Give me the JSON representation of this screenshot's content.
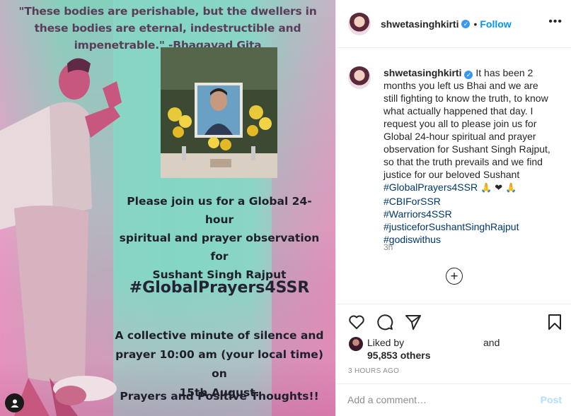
{
  "image": {
    "quote": "\"These bodies are perishable, but the dwellers in these bodies are eternal, indestructible and impenetrable.\" -Bhagavad Gita",
    "join_line1": "Please join us for a Global 24-hour",
    "join_line2": "spiritual and prayer observation for",
    "join_line3": "Sushant Singh Rajput",
    "hashtag": "#GlobalPrayers4SSR",
    "collective_line1": "A collective minute of silence and",
    "collective_line2": "prayer 10:00 am (your local time) on",
    "collective_line3": "15th August.",
    "prayers_line": "Prayers and Positive Thoughts!!"
  },
  "header": {
    "username": "shwetasinghkirti",
    "dot": "•",
    "follow_label": "Follow",
    "more_label": "•••"
  },
  "caption": {
    "username": "shwetasinghkirti",
    "text": "It has been 2 months you left us Bhai and we are still fighting to know the truth, to know what actually happened that day. I request you all to please join us for Global 24-hour spiritual and prayer observation for Sushant Singh Rajput, so that the truth prevails and we find justice for our beloved Sushant",
    "hashtag1": "#GlobalPrayers4SSR",
    "emojis": "🙏 ❤ 🙏",
    "hashtag2": "#CBIForSSR",
    "hashtag3": "#Warriors4SSR",
    "hashtag4": "#justiceforSushantSinghRajput",
    "hashtag5": "#godiswithus",
    "time": "3h"
  },
  "likes": {
    "liked_by": "Liked by",
    "and": "and",
    "others": "95,853 others"
  },
  "posted_time": "3 HOURS AGO",
  "comment": {
    "placeholder": "Add a comment…",
    "post_label": "Post"
  },
  "colors": {
    "accent": "#0095f6",
    "hashtag": "#00376b",
    "muted": "#8e8e8e"
  }
}
